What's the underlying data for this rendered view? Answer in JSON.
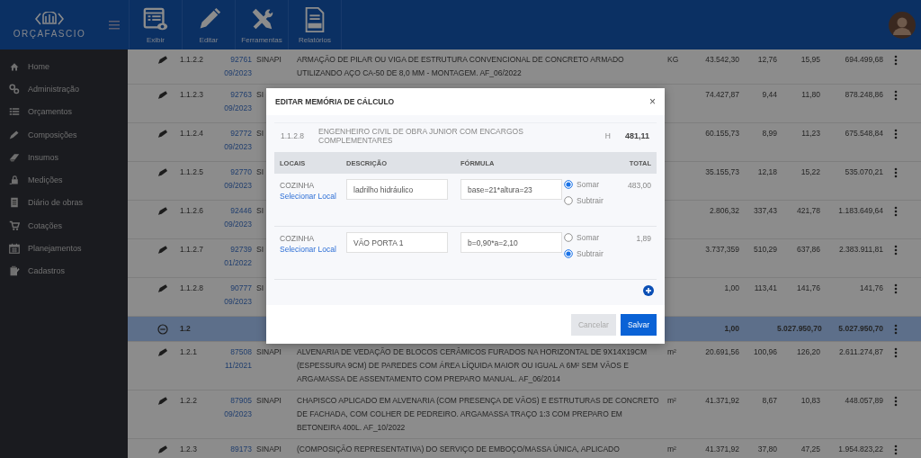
{
  "header": {
    "logo": "ORÇAFASCIO",
    "tools": [
      {
        "label": "Exibir"
      },
      {
        "label": "Editar"
      },
      {
        "label": "Ferramentas"
      },
      {
        "label": "Relatórios"
      }
    ]
  },
  "sidebar": {
    "items": [
      {
        "label": "Home"
      },
      {
        "label": "Administração"
      },
      {
        "label": "Orçamentos"
      },
      {
        "label": "Composições"
      },
      {
        "label": "Insumos"
      },
      {
        "label": "Medições"
      },
      {
        "label": "Diário de obras"
      },
      {
        "label": "Cotações"
      },
      {
        "label": "Planejamentos"
      },
      {
        "label": "Cadastros"
      }
    ]
  },
  "table": {
    "rows": [
      {
        "kind": "item",
        "item": "1.1.2.2",
        "code": "92761",
        "date": "09/2023",
        "source": "SINAPI",
        "description": "ARMAÇÃO DE PILAR OU VIGA DE ESTRUTURA CONVENCIONAL DE CONCRETO ARMADO UTILIZANDO AÇO CA-50 DE 8,0 MM - MONTAGEM. AF_06/2022",
        "unit": "KG",
        "quantity": "43.542,30",
        "unit_cost": "12,76",
        "price": "15,95",
        "total": "694.499,68"
      },
      {
        "kind": "item",
        "item": "1.1.2.3",
        "code": "92763",
        "date": "09/2023",
        "source": "SI",
        "quantity": "74.427,87",
        "unit_cost": "9,44",
        "price": "11,80",
        "total": "878.248,86"
      },
      {
        "kind": "item",
        "item": "1.1.2.4",
        "code": "92772",
        "date": "09/2023",
        "source": "SI",
        "quantity": "60.155,73",
        "unit_cost": "8,99",
        "price": "11,23",
        "total": "675.548,84"
      },
      {
        "kind": "item",
        "item": "1.1.2.5",
        "code": "92770",
        "date": "09/2023",
        "source": "SI",
        "quantity": "35.155,73",
        "unit_cost": "12,18",
        "price": "15,22",
        "total": "535.070,21"
      },
      {
        "kind": "item",
        "item": "1.1.2.6",
        "code": "92446",
        "date": "09/2023",
        "source": "SI",
        "quantity": "2.806,32",
        "unit_cost": "337,43",
        "price": "421,78",
        "total": "1.183.649,64"
      },
      {
        "kind": "item",
        "item": "1.1.2.7",
        "code": "92739",
        "date": "01/2022",
        "source": "SI",
        "quantity": "3.737,359",
        "unit_cost": "510,29",
        "price": "637,86",
        "total": "2.383.911,81"
      },
      {
        "kind": "item",
        "item": "1.1.2.8",
        "code": "90777",
        "date": "09/2023",
        "source": "SI",
        "quantity": "1,00",
        "unit_cost": "113,41",
        "price": "141,76",
        "total": "141,76"
      },
      {
        "kind": "group",
        "item": "1.2",
        "quantity": "1,00",
        "price": "5.027.950,70",
        "total": "5.027.950,70"
      },
      {
        "kind": "item",
        "item": "1.2.1",
        "code": "87508",
        "date": "11/2021",
        "source": "SINAPI",
        "description": "ALVENARIA DE VEDAÇÃO DE BLOCOS CERÂMICOS FURADOS NA HORIZONTAL DE 9X14X19CM (ESPESSURA 9CM) DE PAREDES COM ÁREA LÍQUIDA MAIOR OU IGUAL A 6M² SEM VÃOS E ARGAMASSA DE ASSENTAMENTO COM PREPARO MANUAL. AF_06/2014",
        "unit": "m²",
        "quantity": "20.691,56",
        "unit_cost": "100,96",
        "price": "126,20",
        "total": "2.611.274,87"
      },
      {
        "kind": "item",
        "item": "1.2.2",
        "code": "87905",
        "date": "09/2023",
        "source": "SINAPI",
        "description": "CHAPISCO APLICADO EM ALVENARIA (COM PRESENÇA DE VÃOS) E ESTRUTURAS DE CONCRETO DE FACHADA, COM COLHER DE PEDREIRO. ARGAMASSA TRAÇO 1:3 COM PREPARO EM BETONEIRA 400L. AF_10/2022",
        "unit": "m²",
        "quantity": "41.371,92",
        "unit_cost": "8,67",
        "price": "10,83",
        "total": "448.057,89"
      },
      {
        "kind": "item",
        "item": "1.2.3",
        "code": "89173",
        "source": "SINAPI",
        "description": "(COMPOSIÇÃO REPRESENTATIVA) DO SERVIÇO DE EMBOÇO/MASSA ÚNICA, APLICADO",
        "unit": "m²",
        "quantity": "41.371,92",
        "unit_cost": "37,80",
        "price": "47,25",
        "total": "1.954.823,22"
      }
    ]
  },
  "modal": {
    "title": "EDITAR MEMÓRIA DE CÁLCULO",
    "close": "×",
    "item": {
      "code": "1.1.2.8",
      "description": "ENGENHEIRO CIVIL DE OBRA JUNIOR COM ENCARGOS COMPLEMENTARES",
      "unit": "H",
      "total": "481,11"
    },
    "columns": [
      "LOCAIS",
      "DESCRIÇÃO",
      "FÓRMULA",
      "TOTAL"
    ],
    "rows": [
      {
        "local": "COZINHA",
        "link": "Selecionar Local",
        "description": "ladrilho hidráulico",
        "formula": "base=21*altura=23",
        "options": [
          {
            "label": "Somar",
            "selected": true
          },
          {
            "label": "Subtrair",
            "selected": false
          }
        ],
        "total": "483,00"
      },
      {
        "local": "COZINHA",
        "link": "Selecionar Local",
        "description": "VÃO PORTA 1",
        "formula": "b=0,90*a=2,10",
        "options": [
          {
            "label": "Somar",
            "selected": false
          },
          {
            "label": "Subtrair",
            "selected": true
          }
        ],
        "total": "1,89"
      }
    ],
    "buttons": [
      {
        "label": "Cancelar",
        "disabled": true
      },
      {
        "label": "Salvar",
        "disabled": false
      }
    ]
  }
}
